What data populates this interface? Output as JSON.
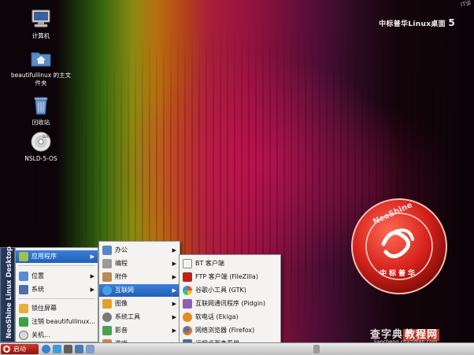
{
  "desktop": {
    "brand": "中标普华Linux桌面",
    "brand_version": "5",
    "watermark": "IT谈",
    "icons": [
      {
        "label": "计算机",
        "icon": "computer-icon"
      },
      {
        "label": "beautifullinux 的主文件夹",
        "icon": "home-folder-icon"
      },
      {
        "label": "回收站",
        "icon": "trash-icon"
      },
      {
        "label": "NSLD-5-OS",
        "icon": "dvd-icon"
      }
    ],
    "logo_text": "NeoShine",
    "logo_caption": "中标普华"
  },
  "side_strip": {
    "label": "NeoShine Linux Desktop"
  },
  "start_menu": {
    "items": [
      {
        "label": "应用程序",
        "selected": true,
        "has_submenu": true
      },
      {
        "label": "位置",
        "selected": false,
        "has_submenu": true
      },
      {
        "label": "系统",
        "selected": false,
        "has_submenu": true
      },
      {
        "label": "锁住屏幕",
        "selected": false,
        "has_submenu": false
      },
      {
        "label": "注销 beautifullinux...",
        "selected": false,
        "has_submenu": false
      },
      {
        "label": "关机...",
        "selected": false,
        "has_submenu": false
      }
    ]
  },
  "apps_menu": {
    "items": [
      {
        "label": "办公"
      },
      {
        "label": "编程"
      },
      {
        "label": "附件"
      },
      {
        "label": "互联网",
        "selected": true
      },
      {
        "label": "图像"
      },
      {
        "label": "系统工具"
      },
      {
        "label": "影音"
      },
      {
        "label": "游戏"
      }
    ]
  },
  "internet_menu": {
    "items": [
      {
        "label": "BT 客户端"
      },
      {
        "label": "FTP 客户端 (FileZilla)"
      },
      {
        "label": "谷歌小工具 (GTK)"
      },
      {
        "label": "互联网通讯程序 (Pidgin)"
      },
      {
        "label": "软电话 (Ekiga)"
      },
      {
        "label": "网络浏览器 (Firefox)"
      },
      {
        "label": "远程桌面查看器"
      }
    ]
  },
  "taskbar": {
    "start_label": "启动"
  },
  "site_watermark": {
    "title_a": "查字典",
    "title_b": "教程网",
    "url": "jiaocheng.chazidian.com"
  },
  "colors": {
    "selection": "#2a6ccb",
    "start_button": "#b3241a"
  }
}
